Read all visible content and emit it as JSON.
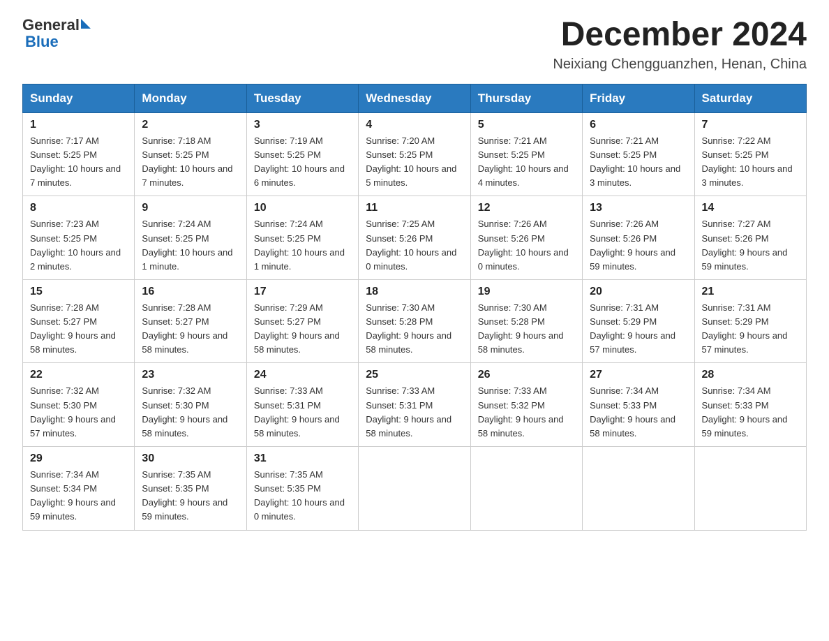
{
  "header": {
    "logo_general": "General",
    "logo_blue": "Blue",
    "title": "December 2024",
    "subtitle": "Neixiang Chengguanzhen, Henan, China"
  },
  "days_of_week": [
    "Sunday",
    "Monday",
    "Tuesday",
    "Wednesday",
    "Thursday",
    "Friday",
    "Saturday"
  ],
  "weeks": [
    [
      {
        "day": "1",
        "sunrise": "7:17 AM",
        "sunset": "5:25 PM",
        "daylight": "10 hours and 7 minutes."
      },
      {
        "day": "2",
        "sunrise": "7:18 AM",
        "sunset": "5:25 PM",
        "daylight": "10 hours and 7 minutes."
      },
      {
        "day": "3",
        "sunrise": "7:19 AM",
        "sunset": "5:25 PM",
        "daylight": "10 hours and 6 minutes."
      },
      {
        "day": "4",
        "sunrise": "7:20 AM",
        "sunset": "5:25 PM",
        "daylight": "10 hours and 5 minutes."
      },
      {
        "day": "5",
        "sunrise": "7:21 AM",
        "sunset": "5:25 PM",
        "daylight": "10 hours and 4 minutes."
      },
      {
        "day": "6",
        "sunrise": "7:21 AM",
        "sunset": "5:25 PM",
        "daylight": "10 hours and 3 minutes."
      },
      {
        "day": "7",
        "sunrise": "7:22 AM",
        "sunset": "5:25 PM",
        "daylight": "10 hours and 3 minutes."
      }
    ],
    [
      {
        "day": "8",
        "sunrise": "7:23 AM",
        "sunset": "5:25 PM",
        "daylight": "10 hours and 2 minutes."
      },
      {
        "day": "9",
        "sunrise": "7:24 AM",
        "sunset": "5:25 PM",
        "daylight": "10 hours and 1 minute."
      },
      {
        "day": "10",
        "sunrise": "7:24 AM",
        "sunset": "5:25 PM",
        "daylight": "10 hours and 1 minute."
      },
      {
        "day": "11",
        "sunrise": "7:25 AM",
        "sunset": "5:26 PM",
        "daylight": "10 hours and 0 minutes."
      },
      {
        "day": "12",
        "sunrise": "7:26 AM",
        "sunset": "5:26 PM",
        "daylight": "10 hours and 0 minutes."
      },
      {
        "day": "13",
        "sunrise": "7:26 AM",
        "sunset": "5:26 PM",
        "daylight": "9 hours and 59 minutes."
      },
      {
        "day": "14",
        "sunrise": "7:27 AM",
        "sunset": "5:26 PM",
        "daylight": "9 hours and 59 minutes."
      }
    ],
    [
      {
        "day": "15",
        "sunrise": "7:28 AM",
        "sunset": "5:27 PM",
        "daylight": "9 hours and 58 minutes."
      },
      {
        "day": "16",
        "sunrise": "7:28 AM",
        "sunset": "5:27 PM",
        "daylight": "9 hours and 58 minutes."
      },
      {
        "day": "17",
        "sunrise": "7:29 AM",
        "sunset": "5:27 PM",
        "daylight": "9 hours and 58 minutes."
      },
      {
        "day": "18",
        "sunrise": "7:30 AM",
        "sunset": "5:28 PM",
        "daylight": "9 hours and 58 minutes."
      },
      {
        "day": "19",
        "sunrise": "7:30 AM",
        "sunset": "5:28 PM",
        "daylight": "9 hours and 58 minutes."
      },
      {
        "day": "20",
        "sunrise": "7:31 AM",
        "sunset": "5:29 PM",
        "daylight": "9 hours and 57 minutes."
      },
      {
        "day": "21",
        "sunrise": "7:31 AM",
        "sunset": "5:29 PM",
        "daylight": "9 hours and 57 minutes."
      }
    ],
    [
      {
        "day": "22",
        "sunrise": "7:32 AM",
        "sunset": "5:30 PM",
        "daylight": "9 hours and 57 minutes."
      },
      {
        "day": "23",
        "sunrise": "7:32 AM",
        "sunset": "5:30 PM",
        "daylight": "9 hours and 58 minutes."
      },
      {
        "day": "24",
        "sunrise": "7:33 AM",
        "sunset": "5:31 PM",
        "daylight": "9 hours and 58 minutes."
      },
      {
        "day": "25",
        "sunrise": "7:33 AM",
        "sunset": "5:31 PM",
        "daylight": "9 hours and 58 minutes."
      },
      {
        "day": "26",
        "sunrise": "7:33 AM",
        "sunset": "5:32 PM",
        "daylight": "9 hours and 58 minutes."
      },
      {
        "day": "27",
        "sunrise": "7:34 AM",
        "sunset": "5:33 PM",
        "daylight": "9 hours and 58 minutes."
      },
      {
        "day": "28",
        "sunrise": "7:34 AM",
        "sunset": "5:33 PM",
        "daylight": "9 hours and 59 minutes."
      }
    ],
    [
      {
        "day": "29",
        "sunrise": "7:34 AM",
        "sunset": "5:34 PM",
        "daylight": "9 hours and 59 minutes."
      },
      {
        "day": "30",
        "sunrise": "7:35 AM",
        "sunset": "5:35 PM",
        "daylight": "9 hours and 59 minutes."
      },
      {
        "day": "31",
        "sunrise": "7:35 AM",
        "sunset": "5:35 PM",
        "daylight": "10 hours and 0 minutes."
      },
      null,
      null,
      null,
      null
    ]
  ]
}
